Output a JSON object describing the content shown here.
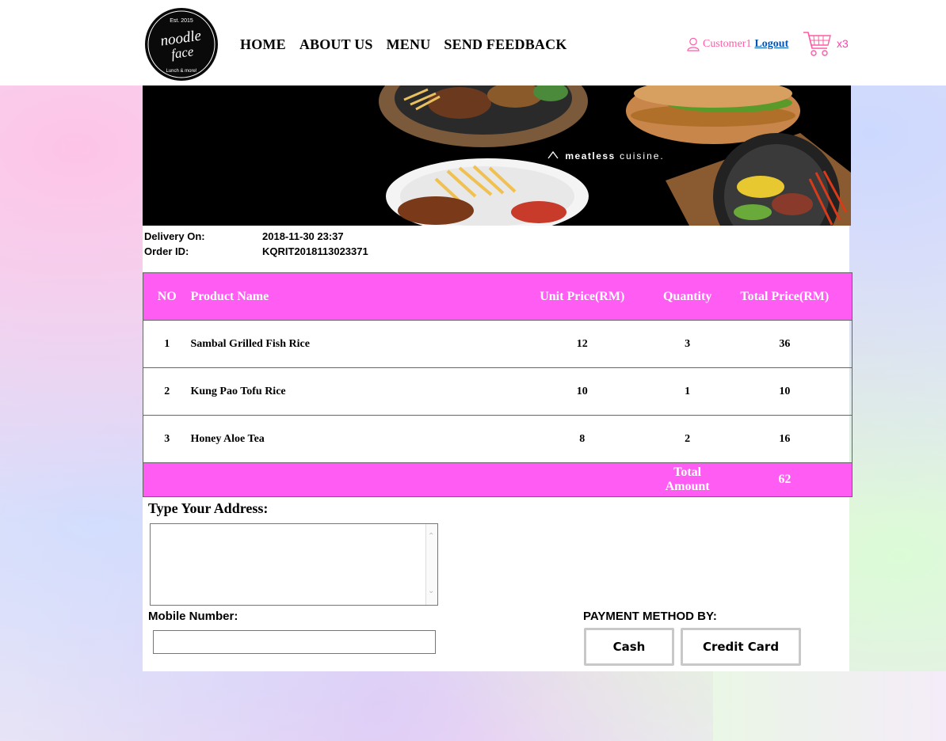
{
  "brand": {
    "logo_text_1": "noodle",
    "logo_text_2": "face",
    "logo_est": "Est. 2015",
    "logo_tagline": "Lunch & more!"
  },
  "nav": [
    {
      "label": "HOME"
    },
    {
      "label": "ABOUT US"
    },
    {
      "label": "MENU"
    },
    {
      "label": "SEND FEEDBACK"
    }
  ],
  "user": {
    "name": "Customer1",
    "logout_label": "Logout"
  },
  "cart": {
    "count": "x3"
  },
  "banner": {
    "tagline_bold": "meatless",
    "tagline_rest": "cuisine."
  },
  "order_info": {
    "delivery_label": "Delivery On:",
    "delivery_value": "2018-11-30 23:37",
    "order_id_label": "Order ID:",
    "order_id_value": "KQRIT2018113023371"
  },
  "table": {
    "headers": [
      "NO",
      "Product Name",
      "Unit Price(RM)",
      "Quantity",
      "Total Price(RM)"
    ],
    "rows": [
      {
        "no": "1",
        "product": "Sambal Grilled Fish Rice",
        "unit_price": "12",
        "quantity": "3",
        "total": "36"
      },
      {
        "no": "2",
        "product": "Kung Pao Tofu Rice",
        "unit_price": "10",
        "quantity": "1",
        "total": "10"
      },
      {
        "no": "3",
        "product": "Honey Aloe Tea",
        "unit_price": "8",
        "quantity": "2",
        "total": "16"
      }
    ],
    "total_label": "Total Amount",
    "total_value": "62"
  },
  "form": {
    "address_label": "Type Your Address:",
    "address_value": "",
    "mobile_label": "Mobile Number:",
    "mobile_value": "",
    "payment_label": "PAYMENT METHOD BY:",
    "payment_cash": "Cash",
    "payment_card": "Credit Card"
  },
  "colors": {
    "accent_pink": "#ff5cf4",
    "user_pink": "#ff5ba6",
    "link_blue": "#0056b8"
  }
}
